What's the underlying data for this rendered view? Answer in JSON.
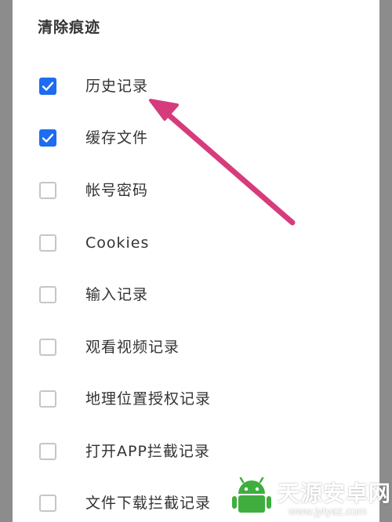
{
  "dialog": {
    "title": "清除痕迹",
    "options": [
      {
        "label": "历史记录",
        "checked": true
      },
      {
        "label": "缓存文件",
        "checked": true
      },
      {
        "label": "帐号密码",
        "checked": false
      },
      {
        "label": "Cookies",
        "checked": false
      },
      {
        "label": "输入记录",
        "checked": false
      },
      {
        "label": "观看视频记录",
        "checked": false
      },
      {
        "label": "地理位置授权记录",
        "checked": false
      },
      {
        "label": "打开APP拦截记录",
        "checked": false
      },
      {
        "label": "文件下载拦截记录",
        "checked": false
      }
    ]
  },
  "annotation": {
    "arrow_icon": "pointer-arrow-icon",
    "arrow_color": "#d63c7c"
  },
  "watermark": {
    "title": "天源安卓网",
    "url": "www.jytyaz.com",
    "logo_icon": "android-logo-icon",
    "logo_color": "#3fae3f"
  },
  "colors": {
    "checked": "#1d6cf2",
    "unchecked_border": "#c6c6c6",
    "backdrop": "#8c8c8c"
  }
}
